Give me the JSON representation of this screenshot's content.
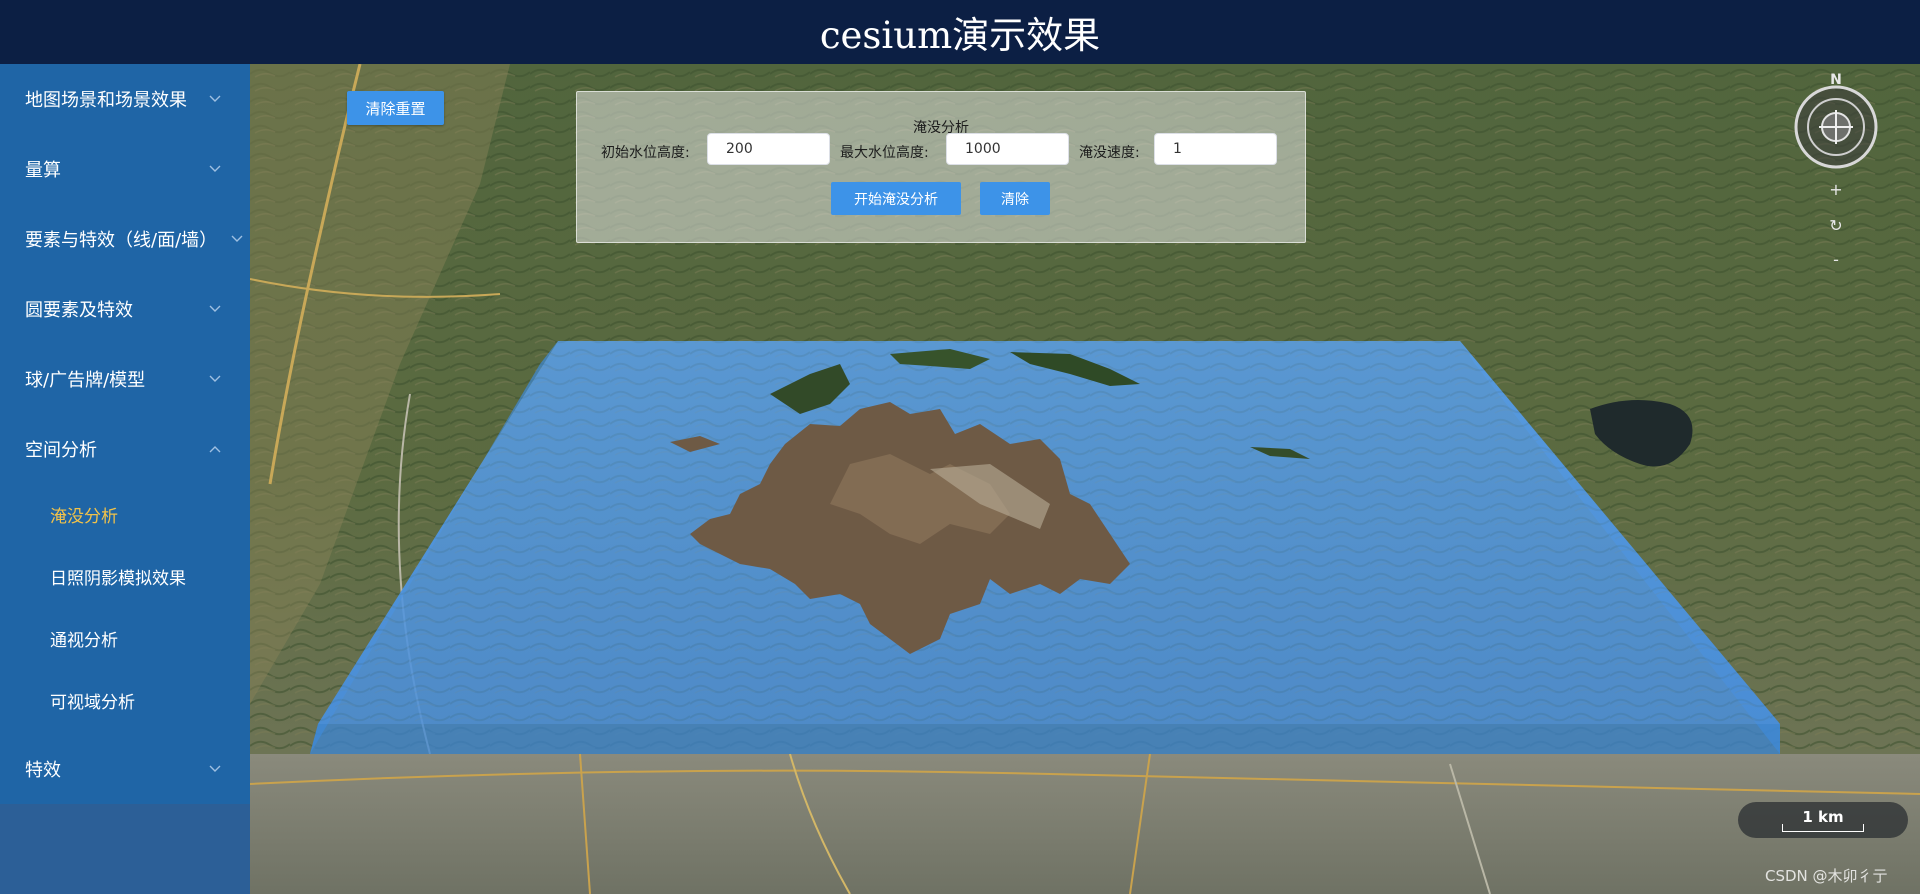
{
  "header": {
    "title": "cesium演示效果"
  },
  "sidebar": {
    "menu": [
      {
        "label": "地图场景和场景效果",
        "expanded": false
      },
      {
        "label": "量算",
        "expanded": false
      },
      {
        "label": "要素与特效（线/面/墙）",
        "expanded": false
      },
      {
        "label": "圆要素及特效",
        "expanded": false
      },
      {
        "label": "球/广告牌/模型",
        "expanded": false
      },
      {
        "label": "空间分析",
        "expanded": true
      },
      {
        "label": "特效",
        "expanded": false
      }
    ],
    "submenu": [
      {
        "label": "淹没分析",
        "active": true
      },
      {
        "label": "日照阴影模拟效果",
        "active": false
      },
      {
        "label": "通视分析",
        "active": false
      },
      {
        "label": "可视域分析",
        "active": false
      }
    ]
  },
  "toolbar": {
    "reset_label": "清除重置"
  },
  "flood_panel": {
    "title": "淹没分析",
    "initial_height_label": "初始水位高度:",
    "initial_height_value": "200",
    "max_height_label": "最大水位高度:",
    "max_height_value": "1000",
    "speed_label": "淹没速度:",
    "speed_value": "1",
    "start_label": "开始淹没分析",
    "clear_label": "清除"
  },
  "navigation": {
    "north_label": "N",
    "zoom_in": "+",
    "reset": "↻",
    "zoom_out": "-"
  },
  "scale": {
    "label": "1 km"
  },
  "watermark": "CSDN @木卯彳亍",
  "colors": {
    "header_bg": "#0c1f44",
    "sidebar_bg": "#1f65a6",
    "active_item": "#f1c24a",
    "button": "#3d93e8",
    "water": "#4a96e6"
  }
}
